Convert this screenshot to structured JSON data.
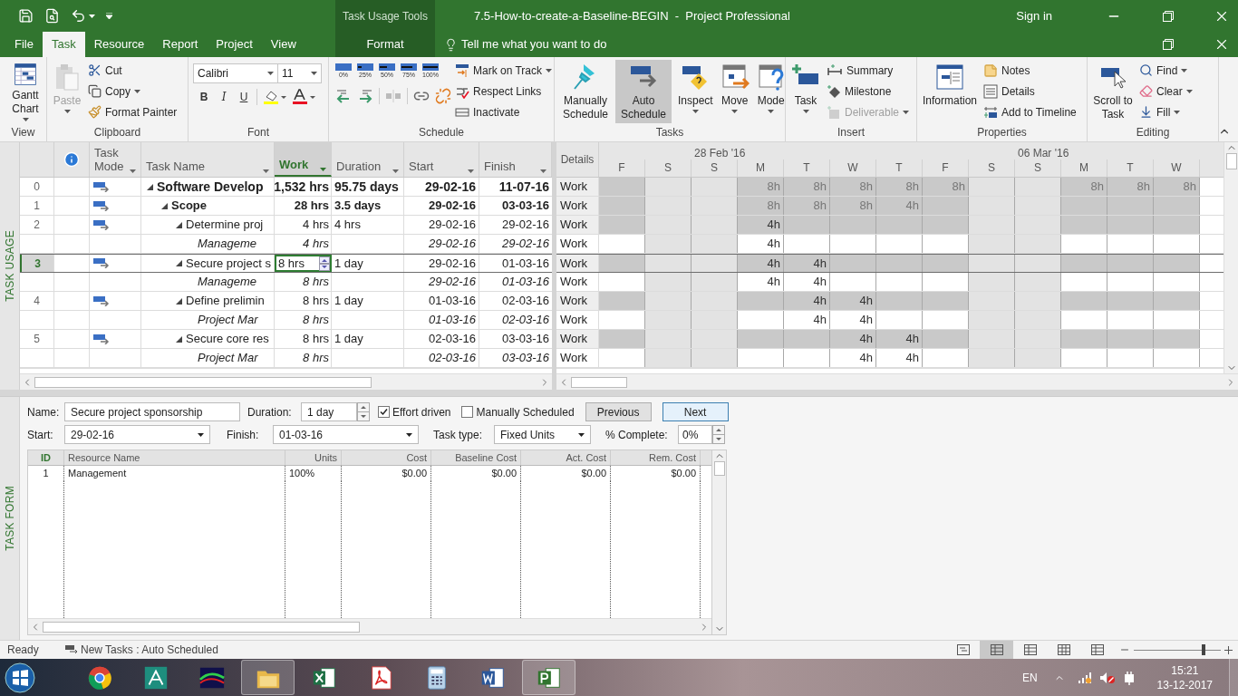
{
  "window": {
    "context_tools": "Task Usage Tools",
    "title": "7.5-How-to-create-a-Baseline-BEGIN  -  Project Professional",
    "sign_in": "Sign in"
  },
  "ribbon_tabs": [
    {
      "label": "File",
      "selected": false,
      "kind": "normal"
    },
    {
      "label": "Task",
      "selected": true,
      "kind": "normal"
    },
    {
      "label": "Resource",
      "selected": false,
      "kind": "normal"
    },
    {
      "label": "Report",
      "selected": false,
      "kind": "normal"
    },
    {
      "label": "Project",
      "selected": false,
      "kind": "normal"
    },
    {
      "label": "View",
      "selected": false,
      "kind": "normal"
    },
    {
      "label": "Format",
      "selected": false,
      "kind": "contextual"
    }
  ],
  "tell_me": "Tell me what you want to do",
  "ribbon": {
    "groups": [
      {
        "label": "View",
        "items": [
          {
            "label": "Gantt Chart"
          }
        ]
      },
      {
        "label": "Clipboard",
        "items": [
          {
            "label": "Paste",
            "disabled": true
          },
          {
            "label": "Cut",
            "disabled": false
          },
          {
            "label": "Copy",
            "disabled": false
          },
          {
            "label": "Format Painter",
            "disabled": false
          }
        ]
      },
      {
        "label": "Font",
        "font": "Calibri",
        "size": "11",
        "items": [
          {
            "label": "B"
          },
          {
            "label": "I"
          },
          {
            "label": "U"
          }
        ]
      },
      {
        "label": "Schedule",
        "items": [
          {
            "label": "0%"
          },
          {
            "label": "25%"
          },
          {
            "label": "50%"
          },
          {
            "label": "75%"
          },
          {
            "label": "100%"
          },
          {
            "label": "Mark on Track"
          },
          {
            "label": "Respect Links"
          },
          {
            "label": "Inactivate"
          }
        ]
      },
      {
        "label": "Tasks",
        "items": [
          {
            "label": "Manually Schedule",
            "selected": false
          },
          {
            "label": "Auto Schedule",
            "selected": true
          },
          {
            "label": "Inspect",
            "selected": false
          },
          {
            "label": "Move",
            "selected": false
          },
          {
            "label": "Mode",
            "selected": false
          }
        ]
      },
      {
        "label": "Insert",
        "items": [
          {
            "label": "Task",
            "disabled": false
          },
          {
            "label": "Summary",
            "disabled": false
          },
          {
            "label": "Milestone",
            "disabled": false
          },
          {
            "label": "Deliverable",
            "disabled": true
          }
        ]
      },
      {
        "label": "Properties",
        "items": [
          {
            "label": "Information"
          },
          {
            "label": "Notes"
          },
          {
            "label": "Details"
          },
          {
            "label": "Add to Timeline"
          }
        ]
      },
      {
        "label": "Editing",
        "items": [
          {
            "label": "Scroll to Task"
          },
          {
            "label": "Find"
          },
          {
            "label": "Clear"
          },
          {
            "label": "Fill"
          }
        ]
      }
    ]
  },
  "task_usage": {
    "side_label": "TASK USAGE",
    "columns": [
      {
        "label": "Task Mode",
        "selected": false
      },
      {
        "label": "Task Name",
        "selected": false
      },
      {
        "label": "Work",
        "selected": true
      },
      {
        "label": "Duration",
        "selected": false
      },
      {
        "label": "Start",
        "selected": false
      },
      {
        "label": "Finish",
        "selected": false
      }
    ],
    "details_header": "Details",
    "weeks": [
      "28 Feb '16",
      "06 Mar '16"
    ],
    "days": [
      {
        "label": "F",
        "working": true
      },
      {
        "label": "S",
        "working": false
      },
      {
        "label": "S",
        "working": false
      },
      {
        "label": "M",
        "working": true
      },
      {
        "label": "T",
        "working": true
      },
      {
        "label": "W",
        "working": true
      },
      {
        "label": "T",
        "working": true
      },
      {
        "label": "F",
        "working": true
      },
      {
        "label": "S",
        "working": false
      },
      {
        "label": "S",
        "working": false
      },
      {
        "label": "M",
        "working": true
      },
      {
        "label": "T",
        "working": true
      },
      {
        "label": "W",
        "working": true
      }
    ],
    "rows": [
      {
        "id": "0",
        "kind": "project",
        "name": "Software Develop",
        "work": "1,532 hrs",
        "duration": "95.75 days",
        "start": "29-02-16",
        "finish": "11-07-16",
        "expanded": true,
        "selected": false,
        "details": "Work",
        "cells": [
          {
            "shaded": true
          },
          {
            "shaded": false
          },
          {
            "shaded": false
          },
          {
            "shaded": true,
            "value": "8h"
          },
          {
            "shaded": true,
            "value": "8h"
          },
          {
            "shaded": true,
            "value": "8h"
          },
          {
            "shaded": true,
            "value": "8h"
          },
          {
            "shaded": true,
            "value": "8h"
          },
          {
            "shaded": false
          },
          {
            "shaded": false
          },
          {
            "shaded": true,
            "value": "8h"
          },
          {
            "shaded": true,
            "value": "8h"
          },
          {
            "shaded": true,
            "value": "8h"
          }
        ],
        "children": [
          {
            "id": "1",
            "kind": "summary",
            "name": "Scope",
            "work": "28 hrs",
            "duration": "3.5 days",
            "start": "29-02-16",
            "finish": "03-03-16",
            "expanded": true,
            "selected": false,
            "details": "Work",
            "cells": [
              {
                "shaded": true
              },
              {
                "shaded": false
              },
              {
                "shaded": false
              },
              {
                "shaded": true,
                "value": "8h"
              },
              {
                "shaded": true,
                "value": "8h"
              },
              {
                "shaded": true,
                "value": "8h"
              },
              {
                "shaded": true,
                "value": "4h"
              },
              {
                "shaded": true
              },
              {
                "shaded": false
              },
              {
                "shaded": false
              },
              {
                "shaded": true
              },
              {
                "shaded": true
              },
              {
                "shaded": true
              }
            ],
            "children": [
              {
                "id": "2",
                "kind": "task",
                "name": "Determine proj",
                "work": "4 hrs",
                "duration": "4 hrs",
                "start": "29-02-16",
                "finish": "29-02-16",
                "expanded": true,
                "selected": false,
                "details": "Work",
                "cells": [
                  {
                    "shaded": true
                  },
                  {
                    "shaded": false
                  },
                  {
                    "shaded": false
                  },
                  {
                    "shaded": true,
                    "value": "4h"
                  },
                  {
                    "shaded": true
                  },
                  {
                    "shaded": true
                  },
                  {
                    "shaded": true
                  },
                  {
                    "shaded": true
                  },
                  {
                    "shaded": false
                  },
                  {
                    "shaded": false
                  },
                  {
                    "shaded": true
                  },
                  {
                    "shaded": true
                  },
                  {
                    "shaded": true
                  }
                ],
                "children": [
                  {
                    "kind": "assignment",
                    "name": "Manageme",
                    "work": "4 hrs",
                    "start": "29-02-16",
                    "finish": "29-02-16",
                    "selected": false,
                    "details": "Work",
                    "cells": [
                      {
                        "shaded": false
                      },
                      {
                        "shaded": false
                      },
                      {
                        "shaded": false
                      },
                      {
                        "shaded": false,
                        "value": "4h"
                      },
                      {
                        "shaded": false
                      },
                      {
                        "shaded": false
                      },
                      {
                        "shaded": false
                      },
                      {
                        "shaded": false
                      },
                      {
                        "shaded": false
                      },
                      {
                        "shaded": false
                      },
                      {
                        "shaded": false
                      },
                      {
                        "shaded": false
                      },
                      {
                        "shaded": false
                      }
                    ]
                  }
                ]
              },
              {
                "id": "3",
                "kind": "task",
                "name": "Secure project s",
                "work": "8 hrs",
                "duration": "1 day",
                "start": "29-02-16",
                "finish": "01-03-16",
                "expanded": true,
                "selected": true,
                "details": "Work",
                "cells": [
                  {
                    "shaded": true
                  },
                  {
                    "shaded": false
                  },
                  {
                    "shaded": false
                  },
                  {
                    "shaded": true,
                    "value": "4h"
                  },
                  {
                    "shaded": true,
                    "value": "4h"
                  },
                  {
                    "shaded": true
                  },
                  {
                    "shaded": true
                  },
                  {
                    "shaded": true
                  },
                  {
                    "shaded": false
                  },
                  {
                    "shaded": false
                  },
                  {
                    "shaded": true
                  },
                  {
                    "shaded": true
                  },
                  {
                    "shaded": true
                  }
                ],
                "children": [
                  {
                    "kind": "assignment",
                    "name": "Manageme",
                    "work": "8 hrs",
                    "start": "29-02-16",
                    "finish": "01-03-16",
                    "selected": false,
                    "details": "Work",
                    "cells": [
                      {
                        "shaded": false
                      },
                      {
                        "shaded": false
                      },
                      {
                        "shaded": false
                      },
                      {
                        "shaded": false,
                        "value": "4h"
                      },
                      {
                        "shaded": false,
                        "value": "4h"
                      },
                      {
                        "shaded": false
                      },
                      {
                        "shaded": false
                      },
                      {
                        "shaded": false
                      },
                      {
                        "shaded": false
                      },
                      {
                        "shaded": false
                      },
                      {
                        "shaded": false
                      },
                      {
                        "shaded": false
                      },
                      {
                        "shaded": false
                      }
                    ]
                  }
                ]
              },
              {
                "id": "4",
                "kind": "task",
                "name": "Define prelimin",
                "work": "8 hrs",
                "duration": "1 day",
                "start": "01-03-16",
                "finish": "02-03-16",
                "expanded": true,
                "selected": false,
                "details": "Work",
                "cells": [
                  {
                    "shaded": true
                  },
                  {
                    "shaded": false
                  },
                  {
                    "shaded": false
                  },
                  {
                    "shaded": true
                  },
                  {
                    "shaded": true,
                    "value": "4h"
                  },
                  {
                    "shaded": true,
                    "value": "4h"
                  },
                  {
                    "shaded": true
                  },
                  {
                    "shaded": true
                  },
                  {
                    "shaded": false
                  },
                  {
                    "shaded": false
                  },
                  {
                    "shaded": true
                  },
                  {
                    "shaded": true
                  },
                  {
                    "shaded": true
                  }
                ],
                "children": [
                  {
                    "kind": "assignment",
                    "name": "Project Mar",
                    "work": "8 hrs",
                    "start": "01-03-16",
                    "finish": "02-03-16",
                    "selected": false,
                    "details": "Work",
                    "cells": [
                      {
                        "shaded": false
                      },
                      {
                        "shaded": false
                      },
                      {
                        "shaded": false
                      },
                      {
                        "shaded": false
                      },
                      {
                        "shaded": false,
                        "value": "4h"
                      },
                      {
                        "shaded": false,
                        "value": "4h"
                      },
                      {
                        "shaded": false
                      },
                      {
                        "shaded": false
                      },
                      {
                        "shaded": false
                      },
                      {
                        "shaded": false
                      },
                      {
                        "shaded": false
                      },
                      {
                        "shaded": false
                      },
                      {
                        "shaded": false
                      }
                    ]
                  }
                ]
              },
              {
                "id": "5",
                "kind": "task",
                "name": "Secure core res",
                "work": "8 hrs",
                "duration": "1 day",
                "start": "02-03-16",
                "finish": "03-03-16",
                "expanded": true,
                "selected": false,
                "details": "Work",
                "cells": [
                  {
                    "shaded": true
                  },
                  {
                    "shaded": false
                  },
                  {
                    "shaded": false
                  },
                  {
                    "shaded": true
                  },
                  {
                    "shaded": true
                  },
                  {
                    "shaded": true,
                    "value": "4h"
                  },
                  {
                    "shaded": true,
                    "value": "4h"
                  },
                  {
                    "shaded": true
                  },
                  {
                    "shaded": false
                  },
                  {
                    "shaded": false
                  },
                  {
                    "shaded": true
                  },
                  {
                    "shaded": true
                  },
                  {
                    "shaded": true
                  }
                ],
                "children": [
                  {
                    "kind": "assignment",
                    "name": "Project Mar",
                    "work": "8 hrs",
                    "start": "02-03-16",
                    "finish": "03-03-16",
                    "selected": false,
                    "details": "Work",
                    "cells": [
                      {
                        "shaded": false
                      },
                      {
                        "shaded": false
                      },
                      {
                        "shaded": false
                      },
                      {
                        "shaded": false
                      },
                      {
                        "shaded": false
                      },
                      {
                        "shaded": false,
                        "value": "4h"
                      },
                      {
                        "shaded": false,
                        "value": "4h"
                      },
                      {
                        "shaded": false
                      },
                      {
                        "shaded": false
                      },
                      {
                        "shaded": false
                      },
                      {
                        "shaded": false
                      },
                      {
                        "shaded": false
                      },
                      {
                        "shaded": false
                      }
                    ]
                  }
                ]
              }
            ]
          }
        ]
      }
    ]
  },
  "task_form": {
    "side_label": "TASK FORM",
    "name_label": "Name:",
    "name": "Secure project sponsorship",
    "duration_label": "Duration:",
    "duration": "1 day",
    "effort_driven": {
      "label": "Effort driven",
      "checked": true
    },
    "manually_scheduled": {
      "label": "Manually Scheduled",
      "checked": false
    },
    "buttons": [
      {
        "label": "Previous",
        "default": false
      },
      {
        "label": "Next",
        "default": true
      }
    ],
    "start_label": "Start:",
    "start": "29-02-16",
    "finish_label": "Finish:",
    "finish": "01-03-16",
    "task_type_label": "Task type:",
    "task_type": "Fixed Units",
    "complete_label": "% Complete:",
    "complete": "0%",
    "columns": [
      "ID",
      "Resource Name",
      "Units",
      "Cost",
      "Baseline Cost",
      "Act. Cost",
      "Rem. Cost"
    ],
    "rows": [
      [
        "1",
        "Management",
        "100%",
        "$0.00",
        "$0.00",
        "$0.00",
        "$0.00"
      ]
    ]
  },
  "status_bar": {
    "ready": "Ready",
    "new_tasks": "New Tasks : Auto Scheduled",
    "zoom": {
      "level": 0.8
    }
  },
  "taskbar": {
    "apps": [
      {
        "active": false
      },
      {
        "active": false
      },
      {
        "active": false
      },
      {
        "active": true
      },
      {
        "active": false
      },
      {
        "active": false
      },
      {
        "active": false
      },
      {
        "active": false
      },
      {
        "active": true
      }
    ],
    "language": "EN",
    "time": "15:21",
    "date": "13-12-2017"
  }
}
